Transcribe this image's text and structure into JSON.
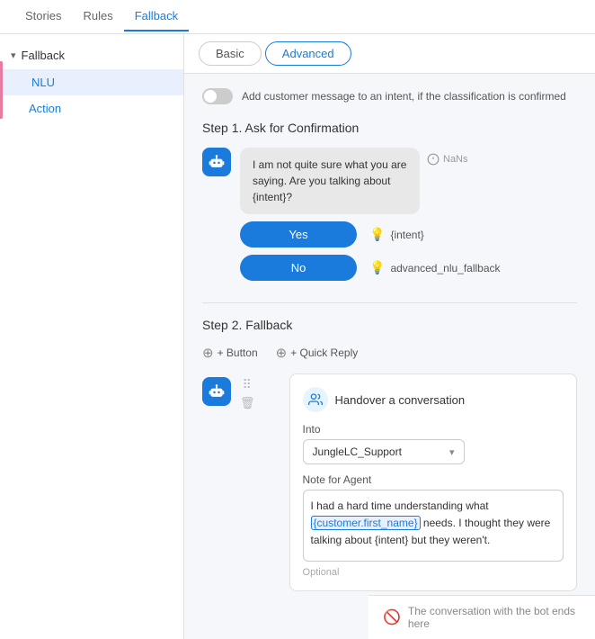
{
  "nav": {
    "items": [
      {
        "label": "Stories",
        "active": false
      },
      {
        "label": "Rules",
        "active": false
      },
      {
        "label": "Fallback",
        "active": true
      }
    ]
  },
  "sidebar": {
    "section_label": "Fallback",
    "items": [
      {
        "label": "NLU",
        "active": true
      },
      {
        "label": "Action",
        "active": false
      }
    ]
  },
  "tabs": {
    "basic_label": "Basic",
    "advanced_label": "Advanced",
    "active": "advanced"
  },
  "toggle": {
    "label": "Add customer message to an intent, if the classification is confirmed",
    "enabled": false
  },
  "step1": {
    "heading": "Step 1. Ask for Confirmation",
    "message": "I am not quite sure what you are saying. Are you talking about {intent}?",
    "nans": "NaNs",
    "yes_label": "Yes",
    "yes_intent": "{intent}",
    "no_label": "No",
    "no_intent": "advanced_nlu_fallback"
  },
  "step2": {
    "heading": "Step 2. Fallback",
    "button_label": "+ Button",
    "quick_reply_label": "+ Quick Reply",
    "card": {
      "title": "Handover a conversation",
      "into_label": "Into",
      "into_value": "JungleLC_Support",
      "note_label": "Note for Agent",
      "note_text_before": "I had a hard time understanding what ",
      "note_highlight": "{customer.first_name}",
      "note_text_after": " needs. I thought they were talking about {intent} but they weren't.",
      "optional_label": "Optional"
    }
  },
  "bottom": {
    "text": "The conversation with the bot ends here"
  }
}
